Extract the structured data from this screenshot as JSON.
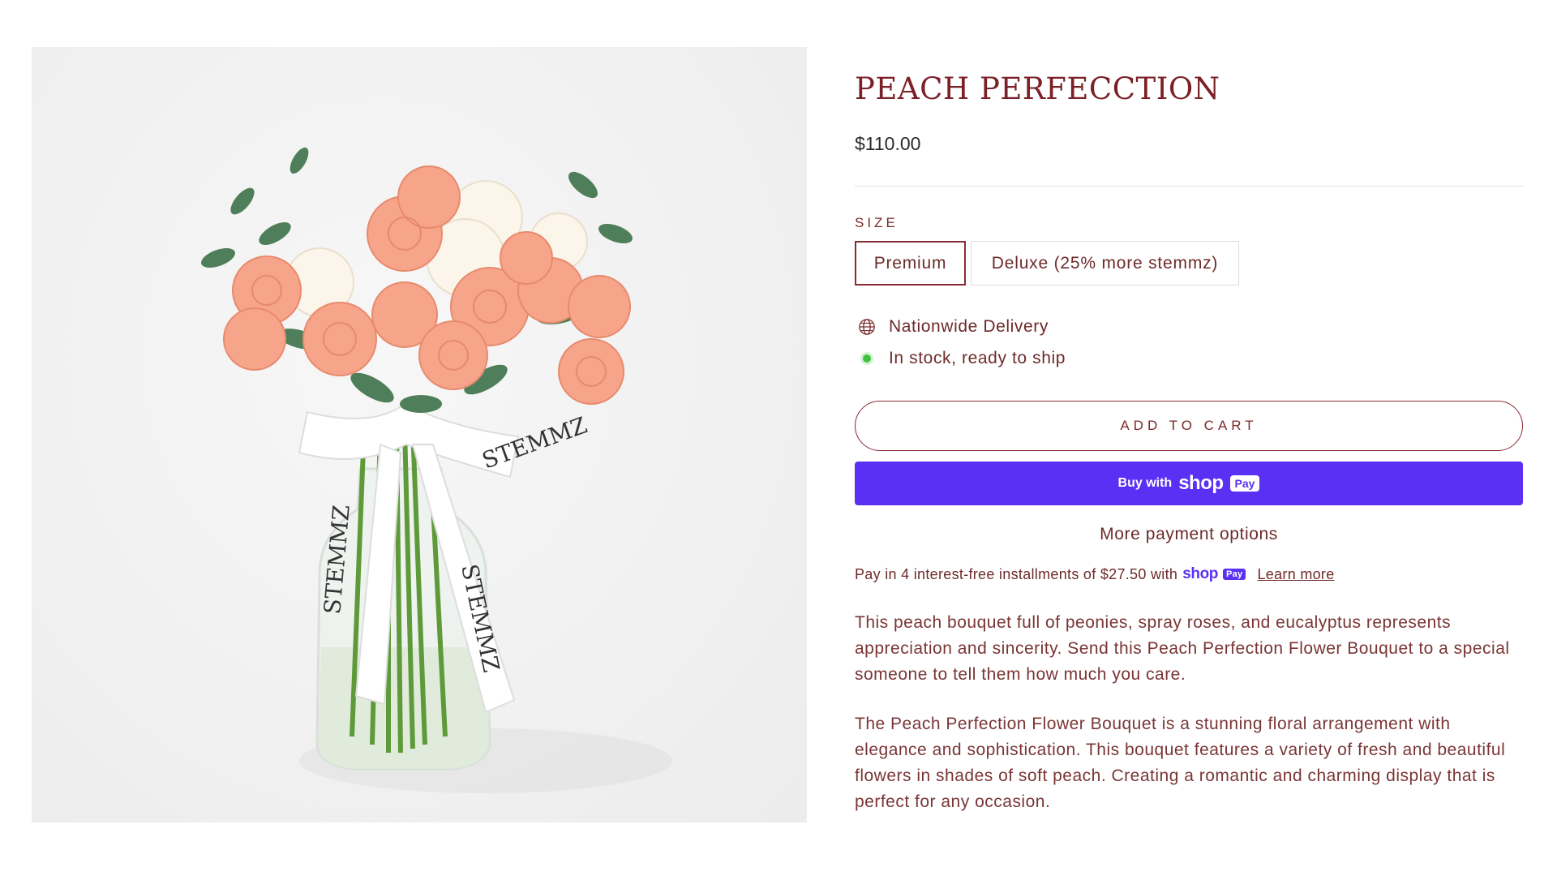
{
  "product": {
    "title": "PEACH PERFECCTION",
    "price": "$110.00",
    "image_ribbon_text": "STEMMZ"
  },
  "size": {
    "label": "SIZE",
    "options": [
      {
        "label": "Premium",
        "selected": true
      },
      {
        "label": "Deluxe (25% more stemmz)",
        "selected": false
      }
    ]
  },
  "meta": {
    "delivery": "Nationwide Delivery",
    "stock": "In stock, ready to ship",
    "delivery_icon": "globe-icon",
    "stock_icon": "green-dot-icon"
  },
  "buttons": {
    "add_to_cart": "ADD TO CART",
    "buy_with": "Buy with",
    "shop_word": "shop",
    "pay_badge": "Pay",
    "more_payment": "More payment options"
  },
  "installments": {
    "text": "Pay in 4 interest-free installments of $27.50 with",
    "shop_word": "shop",
    "pay_badge": "Pay",
    "learn_more": "Learn more"
  },
  "description": {
    "p1": "This peach bouquet full of peonies, spray roses, and eucalyptus represents appreciation and sincerity. Send this Peach Perfection Flower Bouquet to a special someone to tell them how much you care.",
    "p2": "The Peach Perfection Flower Bouquet is a stunning floral arrangement with elegance and sophistication. This bouquet features a variety of fresh and beautiful flowers in shades of soft peach. Creating a romantic and charming display that is perfect for any occasion."
  },
  "colors": {
    "accent": "#7a2026",
    "shop_pay": "#5a31f4",
    "in_stock": "#3fc33f"
  }
}
